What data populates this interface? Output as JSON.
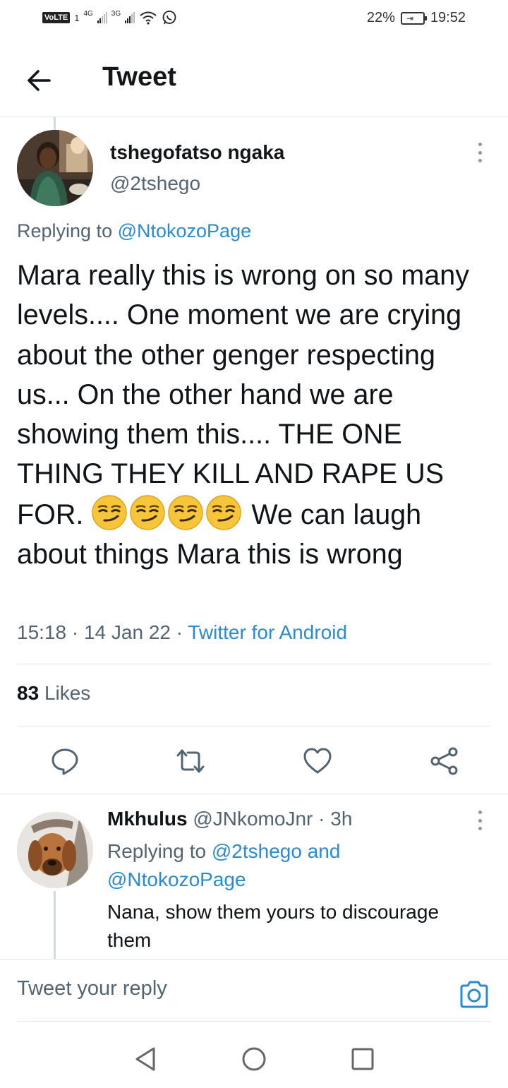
{
  "status_bar": {
    "volte": "VoLTE",
    "sim": "1",
    "net1": "4G",
    "net2": "3G",
    "battery_percent": "22%",
    "time": "19:52"
  },
  "header": {
    "title": "Tweet"
  },
  "tweet": {
    "author_name": "tshegofatso ngaka",
    "author_handle": "@2tshego",
    "replying_prefix": "Replying to ",
    "replying_to": "@NtokozoPage",
    "text_before_emoji": "Mara really this is wrong on so many levels.... One moment we are crying about the other genger respecting us... On the other hand we are showing them this.... THE ONE THING THEY KILL AND RAPE US FOR.",
    "emoji_count": 4,
    "emoji_name": "smirking-face",
    "text_after_emoji": "We can laugh about things Mara this is wrong",
    "time": "15:18",
    "date": "14 Jan 22",
    "source": "Twitter for Android",
    "likes_count": "83",
    "likes_label": "Likes"
  },
  "reply": {
    "author_name": "Mkhulus",
    "author_handle": "@JNkomoJnr",
    "age": "3h",
    "replying_prefix": "Replying to ",
    "replying_to_1": "@2tshego",
    "replying_and": "and",
    "replying_to_2": "@NtokozoPage",
    "text": "Nana, show them yours to discourage them"
  },
  "compose": {
    "placeholder": "Tweet your reply"
  },
  "icons": {
    "back": "arrow-left-icon",
    "reply": "comment-icon",
    "retweet": "retweet-icon",
    "like": "heart-icon",
    "share": "share-icon",
    "camera": "camera-icon",
    "nav_back": "triangle-back-icon",
    "nav_home": "circle-home-icon",
    "nav_recents": "square-recents-icon"
  },
  "colors": {
    "link": "#2a8bd1",
    "secondary_text": "#536471",
    "primary_text": "#0f1419"
  }
}
